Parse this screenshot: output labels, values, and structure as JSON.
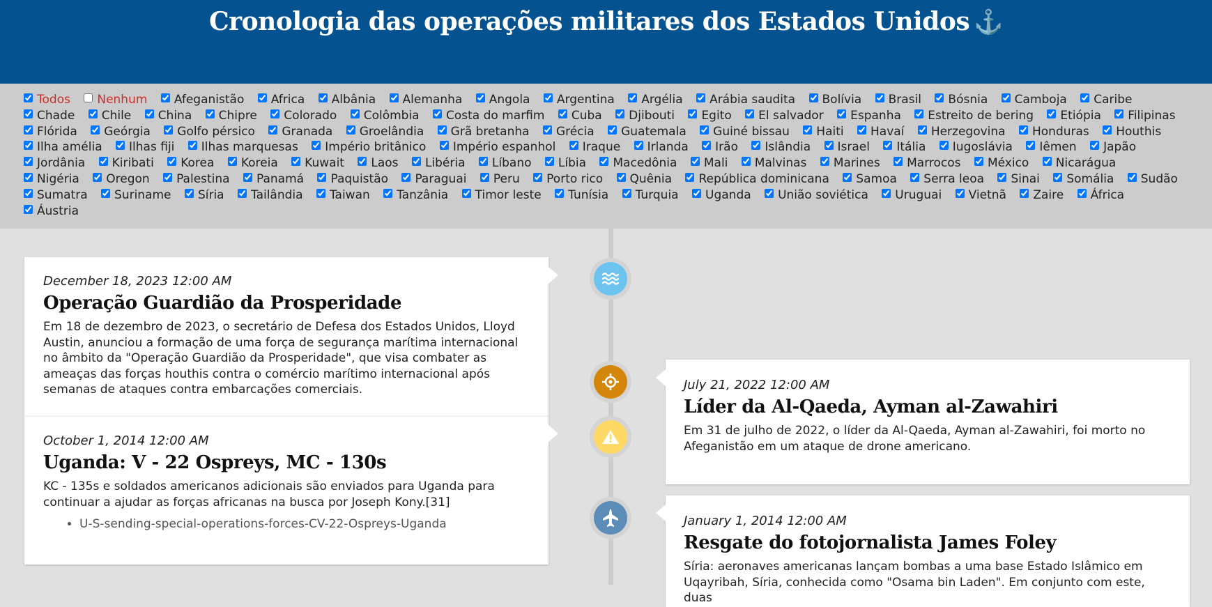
{
  "header": {
    "title": "Cronologia das operações militares dos Estados Unidos",
    "icon": "anchor-icon",
    "anchor_glyph": "⚓"
  },
  "filters": {
    "all_label": "Todos",
    "none_label": "Nenhum",
    "countries": [
      "Afeganistão",
      "Africa",
      "Albânia",
      "Alemanha",
      "Angola",
      "Argentina",
      "Argélia",
      "Arábia saudita",
      "Bolívia",
      "Brasil",
      "Bósnia",
      "Camboja",
      "Caribe",
      "Chade",
      "Chile",
      "China",
      "Chipre",
      "Colorado",
      "Colômbia",
      "Costa do marfim",
      "Cuba",
      "Djibouti",
      "Egito",
      "El salvador",
      "Espanha",
      "Estreito de bering",
      "Etiópia",
      "Filipinas",
      "Flórida",
      "Geórgia",
      "Golfo pérsico",
      "Granada",
      "Groelândia",
      "Grã bretanha",
      "Grécia",
      "Guatemala",
      "Guiné bissau",
      "Haiti",
      "Havaí",
      "Herzegovina",
      "Honduras",
      "Houthis",
      "Ilha amélia",
      "Ilhas fiji",
      "Ilhas marquesas",
      "Império britânico",
      "Império espanhol",
      "Iraque",
      "Irlanda",
      "Irão",
      "Islândia",
      "Israel",
      "Itália",
      "Iugoslávia",
      "Iêmen",
      "Japão",
      "Jordânia",
      "Kiribati",
      "Korea",
      "Koreia",
      "Kuwait",
      "Laos",
      "Libéria",
      "Líbano",
      "Líbia",
      "Macedônia",
      "Mali",
      "Malvinas",
      "Marines",
      "Marrocos",
      "México",
      "Nicarágua",
      "Nigéria",
      "Oregon",
      "Palestina",
      "Panamá",
      "Paquistão",
      "Paraguai",
      "Peru",
      "Porto rico",
      "Quênia",
      "República dominicana",
      "Samoa",
      "Serra leoa",
      "Sinai",
      "Somália",
      "Sudão",
      "Sumatra",
      "Suriname",
      "Síria",
      "Tailândia",
      "Taiwan",
      "Tanzânia",
      "Timor leste",
      "Tunísia",
      "Turquia",
      "Uganda",
      "União soviética",
      "Uruguai",
      "Vietnã",
      "Zaire",
      "África",
      "Áustria"
    ]
  },
  "events": [
    {
      "date": "December 18, 2023 12:00 AM",
      "title": "Operação Guardião da Prosperidade",
      "description": "Em 18 de dezembro de 2023, o secretário de Defesa dos Estados Unidos, Lloyd Austin, anunciou a formação de uma força de segurança marítima internacional no âmbito da \"Operação Guardião da Prosperidade\", que visa combater as ameaças das forças houthis contra o comércio marítimo internacional após semanas de ataques contra embarcações comerciais.",
      "icon": "waves-icon",
      "color": "#6cc3f0"
    },
    {
      "date": "July 21, 2022 12:00 AM",
      "title": "Líder da Al-Qaeda, Ayman al-Zawahiri",
      "description": "Em 31 de julho de 2022, o líder da Al-Qaeda, Ayman al-Zawahiri, foi morto no Afeganistão em um ataque de drone americano.",
      "icon": "crosshair-icon",
      "color": "#d4860b"
    },
    {
      "date": "October 1, 2014 12:00 AM",
      "title": "Uganda: V - 22 Ospreys, MC - 130s",
      "description": "KC - 135s e soldados americanos adicionais são enviados para Uganda para continuar a ajudar as forças africanas na busca por Joseph Kony.[31]",
      "list": [
        "U-S-sending-special-operations-forces-CV-22-Ospreys-Uganda"
      ],
      "icon": "warning-icon",
      "color": "#ffd966"
    },
    {
      "date": "January 1, 2014 12:00 AM",
      "title": "Resgate do fotojornalista James Foley",
      "description": "Síria: aeronaves americanas lançam bombas a uma base Estado Islâmico em Uqayribah, Síria, conhecida como \"Osama bin Laden\". Em conjunto com este, duas",
      "icon": "jet-icon",
      "color": "#5b8db8"
    }
  ]
}
